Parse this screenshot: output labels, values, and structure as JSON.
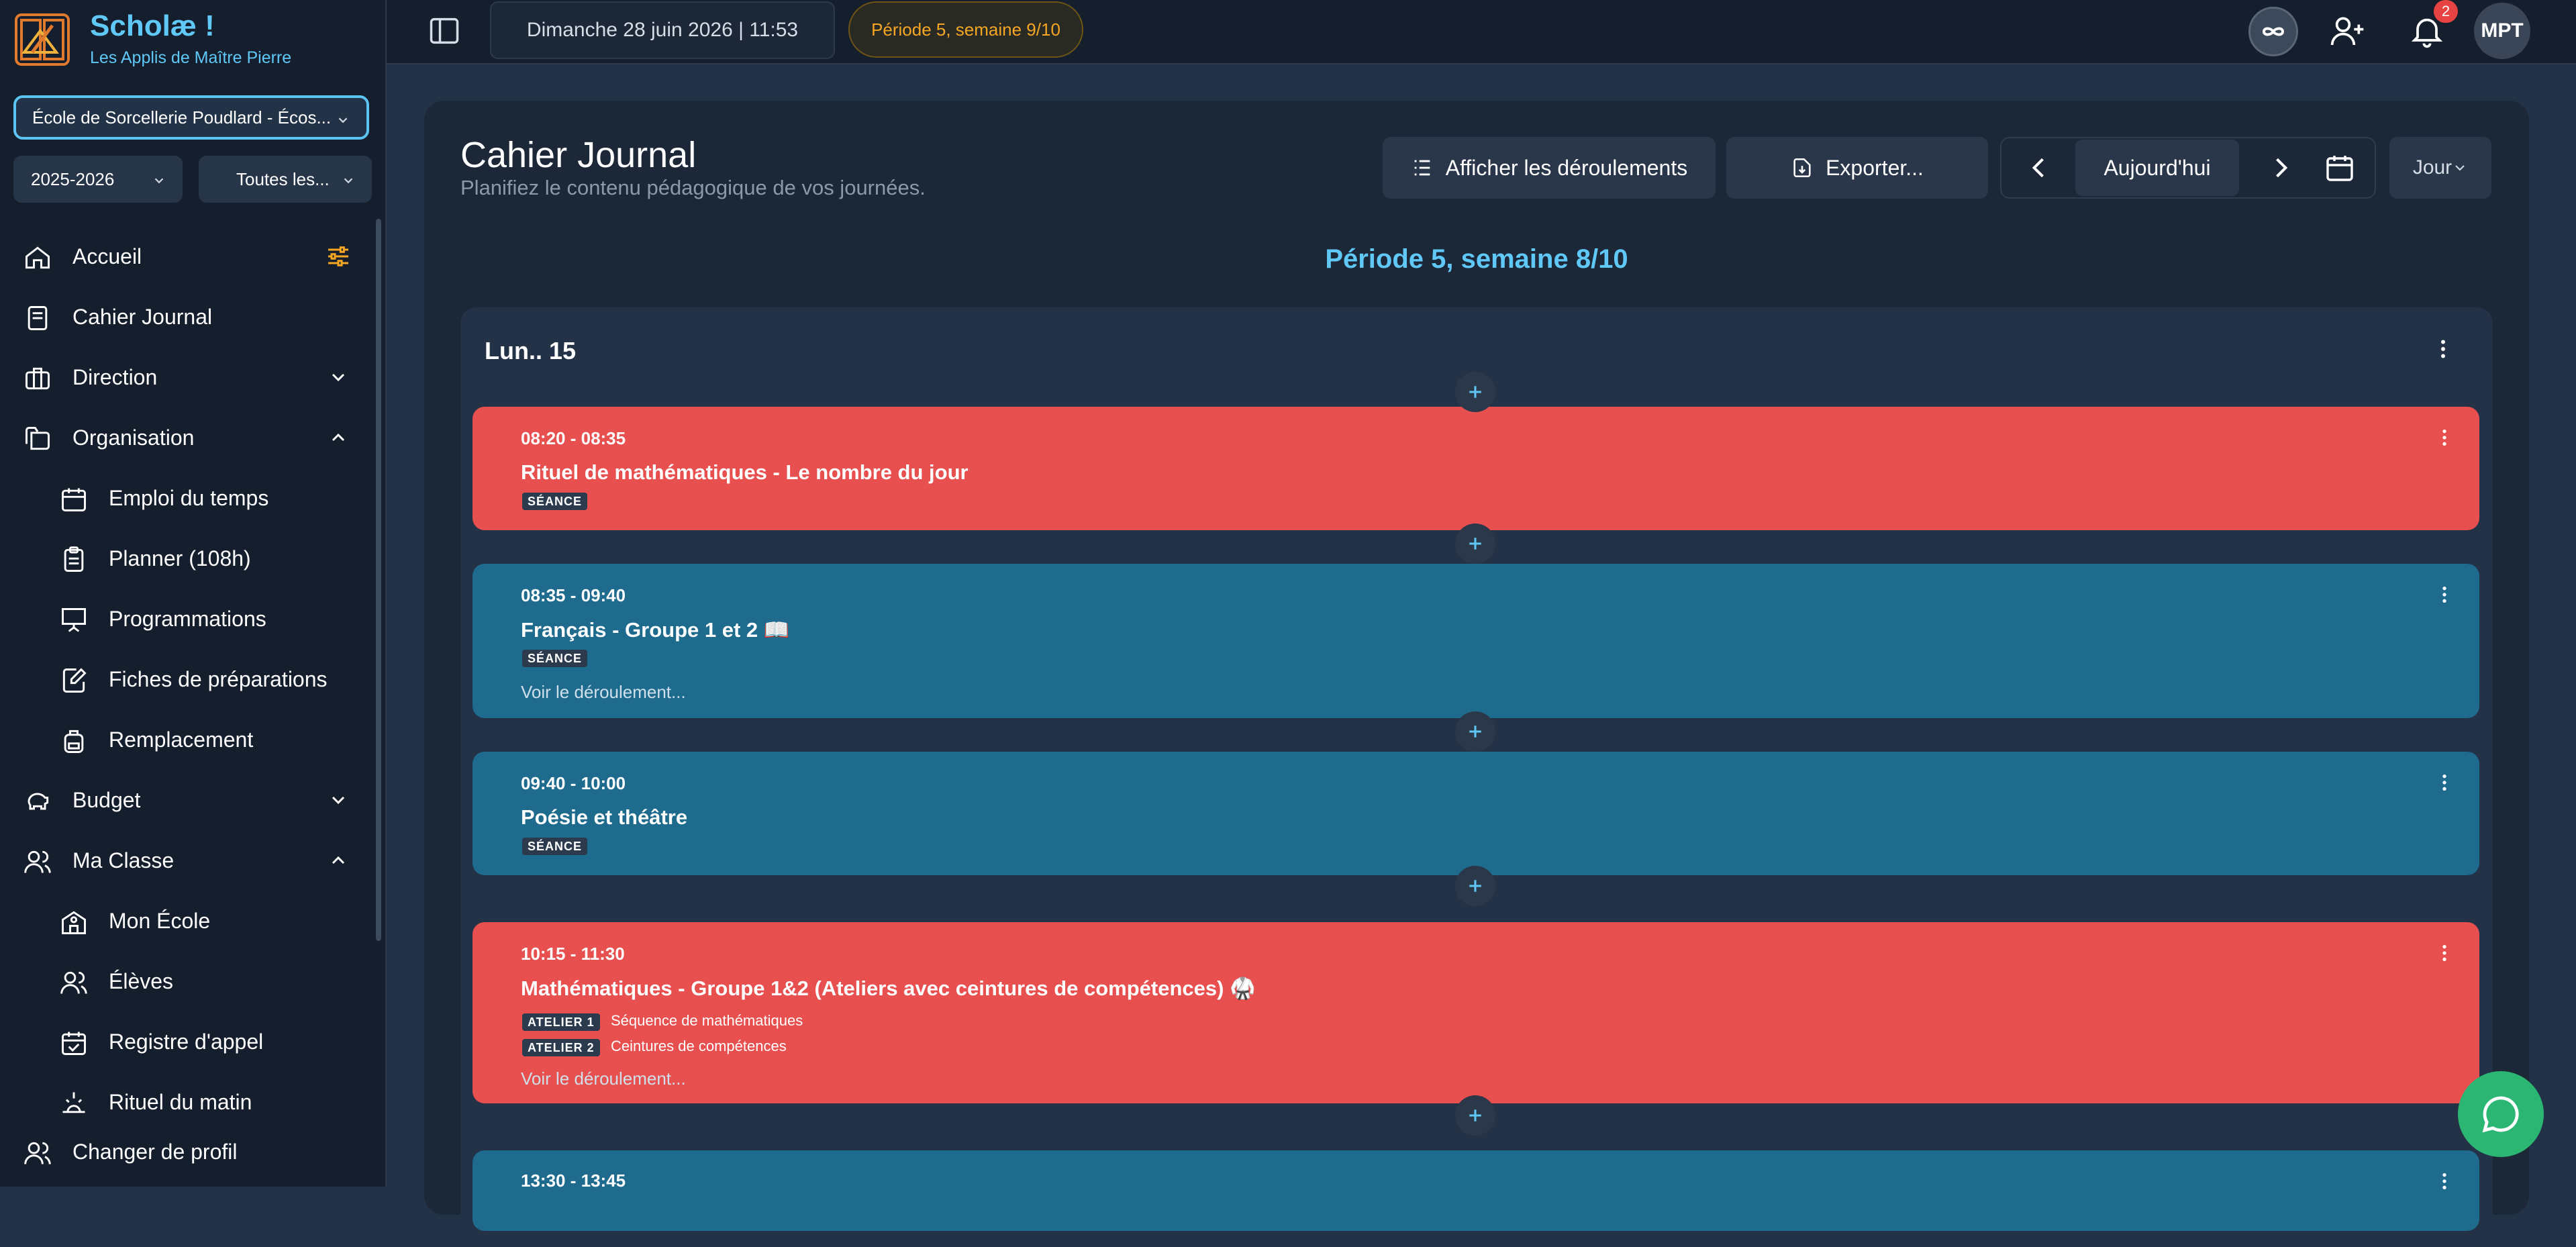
{
  "app": {
    "name": "Scholæ !",
    "subtitle": "Les Applis de Maître Pierre"
  },
  "sidebar": {
    "school_select": "École de Sorcellerie Poudlard - Écos...",
    "year_select": "2025-2026",
    "group_select": "Toutes les...",
    "items": [
      {
        "label": "Accueil",
        "icon": "home-icon"
      },
      {
        "label": "Cahier Journal",
        "icon": "book-icon"
      },
      {
        "label": "Direction",
        "icon": "briefcase-icon",
        "state": "collapsed"
      },
      {
        "label": "Organisation",
        "icon": "folders-icon",
        "state": "expanded"
      },
      {
        "label": "Emploi du temps",
        "icon": "calendar-icon"
      },
      {
        "label": "Planner (108h)",
        "icon": "clipboard-icon"
      },
      {
        "label": "Programmations",
        "icon": "presentation-icon"
      },
      {
        "label": "Fiches de préparations",
        "icon": "edit-file-icon"
      },
      {
        "label": "Remplacement",
        "icon": "backpack-icon"
      },
      {
        "label": "Budget",
        "icon": "piggy-bank-icon",
        "state": "collapsed"
      },
      {
        "label": "Ma Classe",
        "icon": "users-icon",
        "state": "expanded"
      },
      {
        "label": "Mon École",
        "icon": "school-icon"
      },
      {
        "label": "Élèves",
        "icon": "users-icon"
      },
      {
        "label": "Registre d'appel",
        "icon": "calendar-check-icon"
      },
      {
        "label": "Rituel du matin",
        "icon": "sunrise-icon"
      },
      {
        "label": "Changer de profil",
        "icon": "users-icon"
      }
    ]
  },
  "topbar": {
    "date": "Dimanche 28 juin 2026  |  11:53",
    "period": "Période 5, semaine 9/10",
    "notification_count": "2",
    "avatar": "MPT"
  },
  "page": {
    "title": "Cahier Journal",
    "subtitle": "Planifiez le contenu pédagogique de vos journées.",
    "show_steps_button": "Afficher les déroulements",
    "export_button": "Exporter...",
    "today_button": "Aujourd'hui",
    "view_select": "Jour",
    "week_heading": "Période 5, semaine 8/10"
  },
  "day": {
    "label": "Lun.. 15",
    "slots": [
      {
        "time": "08:20 - 08:35",
        "title": "Rituel de mathématiques - Le nombre du jour",
        "tag": "SÉANCE",
        "color": "#e84f4f"
      },
      {
        "time": "08:35 - 09:40",
        "title": "Français - Groupe 1 et 2 📖",
        "tag": "SÉANCE",
        "link": "Voir le déroulement...",
        "color": "#1f6b8e"
      },
      {
        "time": "09:40 - 10:00",
        "title": "Poésie et théâtre",
        "tag": "SÉANCE",
        "color": "#1f6b8e"
      },
      {
        "time": "10:15 - 11:30",
        "title": "Mathématiques - Groupe 1&2 (Ateliers avec ceintures de compétences) 🥋",
        "ateliers": [
          {
            "tag": "ATELIER 1",
            "text": "Séquence de mathématiques"
          },
          {
            "tag": "ATELIER 2",
            "text": "Ceintures de compétences"
          }
        ],
        "link": "Voir le déroulement...",
        "color": "#e84f4f"
      },
      {
        "time": "13:30 - 13:45",
        "color": "#1f6b8e"
      }
    ]
  },
  "colors": {
    "accent": "#5fc8f7",
    "period": "#f5a623",
    "red_slot": "#e84f4f",
    "blue_slot": "#1f6b8e",
    "fab": "#2bb673"
  }
}
